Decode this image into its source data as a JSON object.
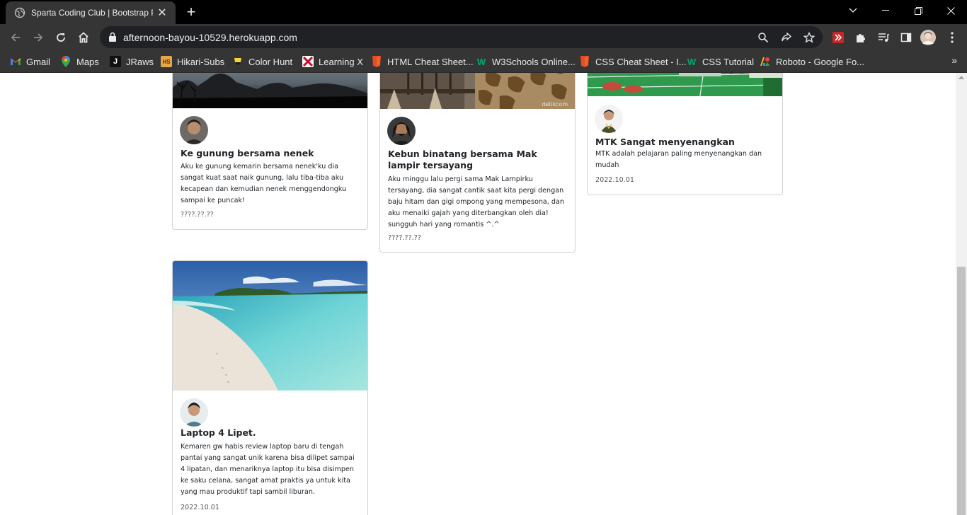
{
  "browser": {
    "tab_title": "Sparta Coding Club | Bootstrap P",
    "url": "afternoon-bayou-10529.herokuapp.com"
  },
  "bookmarks": [
    {
      "label": "Gmail",
      "icon": "gmail-icon"
    },
    {
      "label": "Maps",
      "icon": "maps-icon"
    },
    {
      "label": "JRaws",
      "icon": "jraws-icon"
    },
    {
      "label": "Hikari-Subs",
      "icon": "hikari-icon"
    },
    {
      "label": "Color Hunt",
      "icon": "colorhunt-icon"
    },
    {
      "label": "Learning X",
      "icon": "learningx-icon"
    },
    {
      "label": "HTML Cheat Sheet...",
      "icon": "html5-icon"
    },
    {
      "label": "W3Schools Online...",
      "icon": "w3schools-icon"
    },
    {
      "label": "CSS Cheat Sheet - I...",
      "icon": "html5-icon"
    },
    {
      "label": "CSS Tutorial",
      "icon": "w3schools-icon"
    },
    {
      "label": "Roboto - Google Fo...",
      "icon": "googlefonts-icon"
    }
  ],
  "bookmarks_overflow": "»",
  "cards": [
    {
      "title": "Ke gunung bersama nenek",
      "text": "Aku ke gunung kemarin bersama nenek'ku dia sangat kuat saat naik gunung, lalu tiba-tiba aku kecapean dan kemudian nenek menggendongku sampai ke puncak!",
      "date": "????.??.??",
      "image": "mountain-image"
    },
    {
      "title": "Kebun binatang bersama Mak lampir tersayang",
      "text": "Aku minggu lalu pergi sama Mak Lampirku tersayang, dia sangat cantik saat kita pergi dengan baju hitam dan gigi ompong yang mempesona, dan aku menaiki gajah yang diterbangkan oleh dia! sungguh hari yang romantis ^.^",
      "date": "????.??.??",
      "image": "zoo-giraffe-image",
      "watermark": "detikcom"
    },
    {
      "title": "MTK Sangat menyenangkan",
      "text": "MTK adalah pelajaran paling menyenangkan dan mudah",
      "date": "2022.10.01",
      "image": "sports-court-image"
    },
    {
      "title": "Laptop 4 Lipet.",
      "text": "Kemaren gw habis review laptop baru di tengah pantai yang sangat unik karena bisa dilipet sampai 4 lipatan, dan menariknya laptop itu bisa disimpen ke saku celana, sangat amat praktis ya untuk kita yang mau produktif tapi sambil liburan.",
      "date": "2022.10.01",
      "image": "beach-image"
    }
  ],
  "colors": {
    "chrome_dark": "#353535",
    "titlebar": "#000000",
    "omnibox": "#202124",
    "card_border": "#d9d9d9"
  }
}
